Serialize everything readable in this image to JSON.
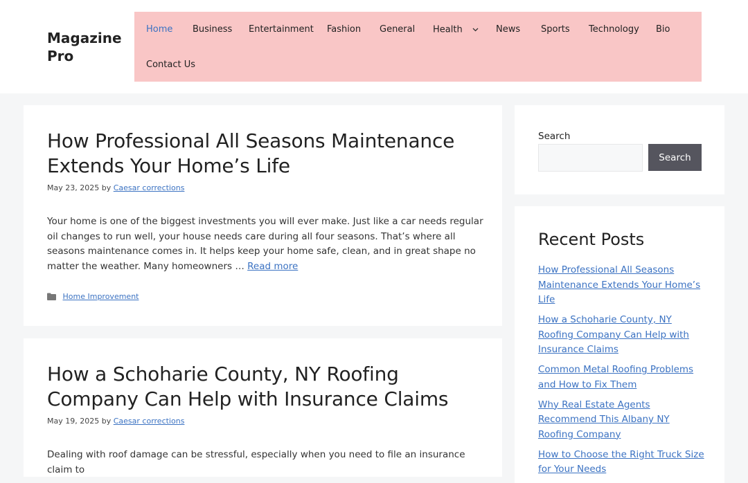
{
  "site": {
    "title": "Magazine Pro"
  },
  "nav": {
    "items": [
      {
        "label": "Home",
        "active": true
      },
      {
        "label": "Business"
      },
      {
        "label": "Entertainment"
      },
      {
        "label": "Fashion"
      },
      {
        "label": "General"
      },
      {
        "label": "Health",
        "has_submenu": true
      },
      {
        "label": "News"
      },
      {
        "label": "Sports"
      },
      {
        "label": "Technology"
      },
      {
        "label": "Bio"
      },
      {
        "label": "Contact Us"
      }
    ],
    "background": "#f9c6c6",
    "active_color": "#3b72c2"
  },
  "posts": [
    {
      "title": "How Professional All Seasons Maintenance Extends Your Home’s Life",
      "date": "May 23, 2025",
      "by": "by",
      "author": "Caesar corrections",
      "excerpt": "Your home is one of the biggest investments you will ever make. Just like a car needs regular oil changes to run well, your house needs care during all four seasons. That’s where all seasons maintenance comes in. It helps keep your home safe, clean, and in great shape no matter the weather. Many homeowners …",
      "read_more": "Read more",
      "category": "Home Improvement"
    },
    {
      "title": "How a Schoharie County, NY Roofing Company Can Help with Insurance Claims",
      "date": "May 19, 2025",
      "by": "by",
      "author": "Caesar corrections",
      "excerpt": "Dealing with roof damage can be stressful, especially when you need to file an insurance claim to"
    }
  ],
  "sidebar": {
    "search": {
      "label": "Search",
      "placeholder": "",
      "button": "Search"
    },
    "recent": {
      "title": "Recent Posts",
      "items": [
        "How Professional All Seasons Maintenance Extends Your Home’s Life",
        "How a Schoharie County, NY Roofing Company Can Help with Insurance Claims",
        "Common Metal Roofing Problems and How to Fix Them",
        "Why Real Estate Agents Recommend This Albany NY Roofing Company",
        "How to Choose the Right Truck Size for Your Needs"
      ]
    }
  },
  "icons": {
    "folder": "folder-icon",
    "chevron": "chevron-down-icon"
  },
  "colors": {
    "link": "#3b72c2",
    "search_button": "#55555e",
    "page_bg": "#f5f6f7"
  }
}
